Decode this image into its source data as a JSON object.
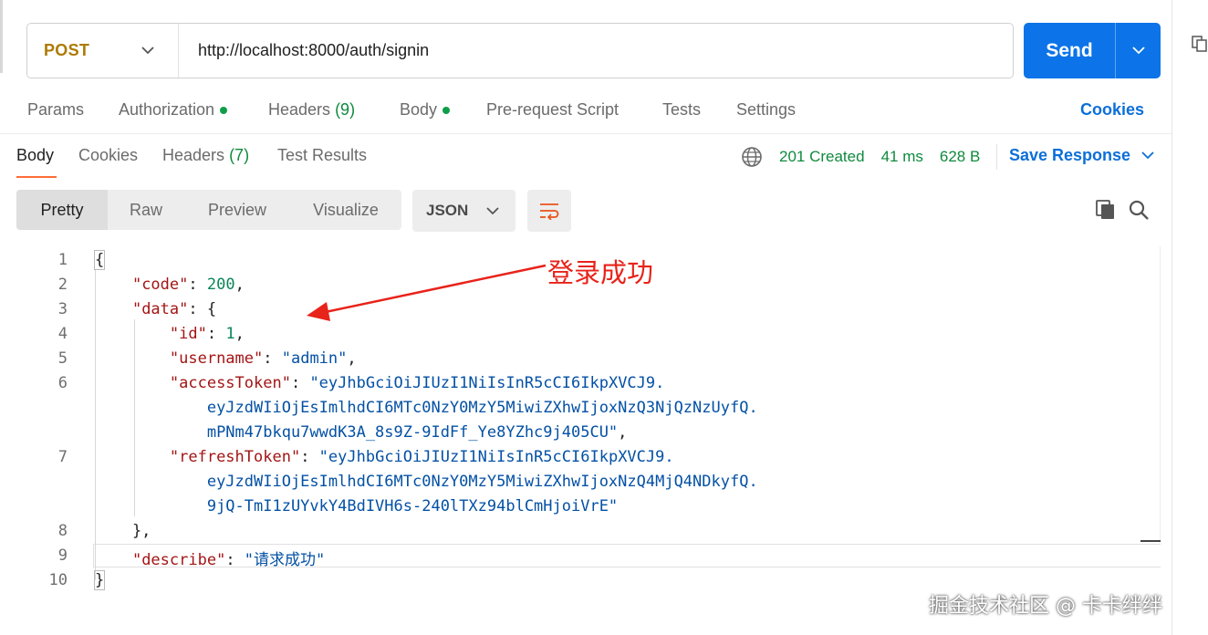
{
  "request": {
    "method": "POST",
    "url": "http://localhost:8000/auth/signin",
    "send_label": "Send"
  },
  "request_tabs": {
    "params": "Params",
    "authorization": "Authorization",
    "headers": "Headers",
    "headers_count": "(9)",
    "body": "Body",
    "pre_request": "Pre-request Script",
    "tests": "Tests",
    "settings": "Settings",
    "cookies": "Cookies"
  },
  "response_tabs": {
    "body": "Body",
    "cookies": "Cookies",
    "headers": "Headers",
    "headers_count": "(7)",
    "test_results": "Test Results"
  },
  "response_status": {
    "status": "201 Created",
    "time": "41 ms",
    "size": "628 B",
    "save_response": "Save Response"
  },
  "format_toolbar": {
    "pretty": "Pretty",
    "raw": "Raw",
    "preview": "Preview",
    "visualize": "Visualize",
    "language": "JSON"
  },
  "code": {
    "line_numbers": [
      "1",
      "2",
      "3",
      "4",
      "5",
      "6",
      "7",
      "8",
      "9",
      "10"
    ],
    "key_code": "\"code\"",
    "val_code": "200",
    "key_data": "\"data\"",
    "key_id": "\"id\"",
    "val_id": "1",
    "key_username": "\"username\"",
    "val_username": "\"admin\"",
    "key_access": "\"accessToken\"",
    "access_1": "\"eyJhbGciOiJIUzI1NiIsInR5cCI6IkpXVCJ9.",
    "access_2": "eyJzdWIiOjEsImlhdCI6MTc0NzY0MzY5MiwiZXhwIjoxNzQ3NjQzNzUyfQ.",
    "access_3": "mPNm47bkqu7wwdK3A_8s9Z-9IdFf_Ye8YZhc9j405CU\"",
    "key_refresh": "\"refreshToken\"",
    "refresh_1": "\"eyJhbGciOiJIUzI1NiIsInR5cCI6IkpXVCJ9.",
    "refresh_2": "eyJzdWIiOjEsImlhdCI6MTc0NzY0MzY5MiwiZXhwIjoxNzQ4MjQ4NDkyfQ.",
    "refresh_3": "9jQ-TmI1zUYvkY4BdIVH6s-240lTXz94blCmHjoiVrE\"",
    "key_describe": "\"describe\"",
    "val_describe": "\"请求成功\""
  },
  "annotation": "登录成功",
  "watermark": "掘金技术社区 @ 卡卡绊绊",
  "colors": {
    "send_bg": "#0c74e8",
    "method": "#ad7a03",
    "status_green": "#0f8a3e",
    "link_blue": "#0c6fd9",
    "annotation_red": "#e8231a"
  },
  "icons": [
    "chevron-down-icon",
    "globe-icon",
    "wrap-lines-icon",
    "copy-icon",
    "search-icon",
    "side-panel-icon"
  ]
}
